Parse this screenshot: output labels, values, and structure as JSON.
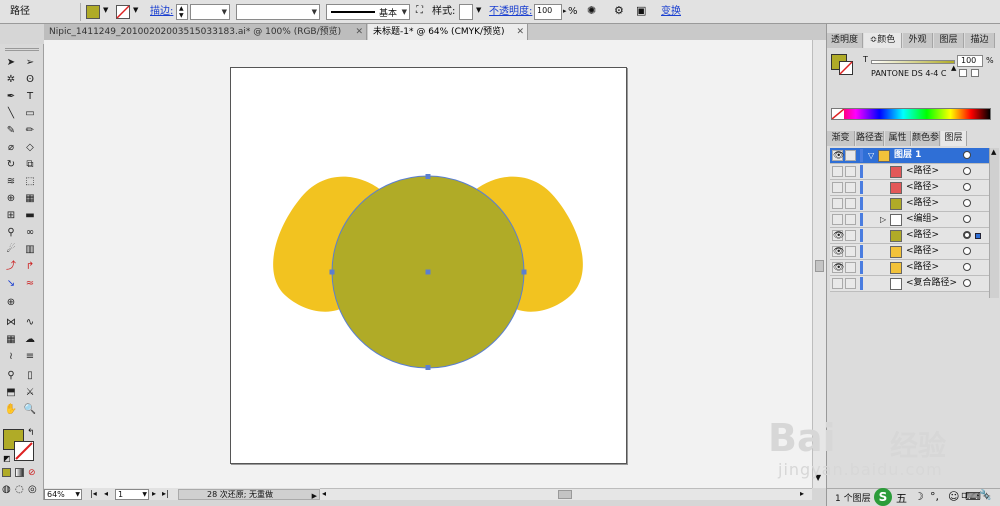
{
  "control_bar": {
    "selection_label": "路径",
    "stroke_label": "描边:",
    "stroke_style": "基本",
    "style_label": "样式:",
    "opacity_label": "不透明度:",
    "opacity_value": "100",
    "opacity_unit": "%",
    "transform_label": "变换"
  },
  "doc_tabs": [
    {
      "label": "Nipic_1411249_20100202003515033183.ai* @ 100% (RGB/预览)"
    },
    {
      "label": "未标题-1* @ 64% (CMYK/预览)"
    }
  ],
  "status_bar": {
    "zoom": "64%",
    "page": "1",
    "history": "28 次还原; 无重做"
  },
  "color_panel": {
    "tabs": [
      "透明度",
      "颜色",
      "外观",
      "图层",
      "描边"
    ],
    "tint_label": "T",
    "tint_value": "100",
    "tint_unit": "%",
    "swatch_name": "PANTONE DS 4-4 C",
    "fill_color": "#b0ab27"
  },
  "layers_panel": {
    "tabs": [
      "渐变",
      "路径查",
      "属性",
      "颜色参",
      "图层"
    ],
    "rows": [
      {
        "name": "图层 1",
        "thumb_color": "#f2c23a",
        "eye": "👁"
      },
      {
        "name": "<路径>",
        "thumb_color": "#e25858",
        "eye": ""
      },
      {
        "name": "<路径>",
        "thumb_color": "#e25858",
        "eye": ""
      },
      {
        "name": "<路径>",
        "thumb_color": "#b0ab27",
        "eye": ""
      },
      {
        "name": "<编组>",
        "thumb_color": "#ffffff",
        "eye": ""
      },
      {
        "name": "<路径>",
        "thumb_color": "#b0ab27",
        "eye": "👁"
      },
      {
        "name": "<路径>",
        "thumb_color": "#f2c23a",
        "eye": "👁"
      },
      {
        "name": "<路径>",
        "thumb_color": "#f2c23a",
        "eye": "👁"
      },
      {
        "name": "<复合路径>",
        "thumb_color": "#ffffff",
        "eye": ""
      }
    ],
    "footer": "1 个图层"
  },
  "artwork": {
    "ear_color": "#f2c320",
    "face_color": "#b0ab27",
    "anchor_color": "#5b7fd1"
  },
  "watermark": {
    "brand": "Bai",
    "brand2": "经验",
    "url": "jingyan.baidu.com"
  },
  "taskbar": {
    "ime_label": "五"
  }
}
